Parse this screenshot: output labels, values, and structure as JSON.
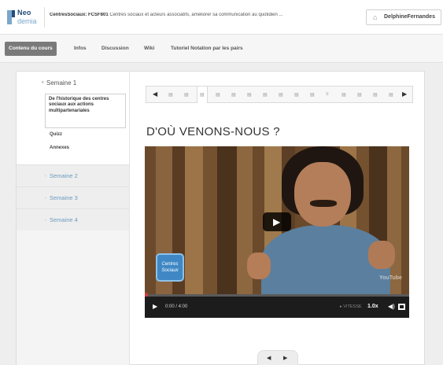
{
  "header": {
    "logo_top": "Neo",
    "logo_bottom": "demia",
    "course_code": "CentresSociaux: FCSF801",
    "course_name": "Centres sociaux et acteurs associatifs, améliorer sa communication au quotidien ...",
    "user_icon": "home-icon",
    "user_name": "DelphineFernandes"
  },
  "tabs": [
    {
      "label": "Contenu du cours",
      "active": true
    },
    {
      "label": "Infos",
      "active": false
    },
    {
      "label": "Discussion",
      "active": false
    },
    {
      "label": "Wiki",
      "active": false
    },
    {
      "label": "Tutoriel Notation par les pairs",
      "active": false
    }
  ],
  "sidebar": {
    "open_week": "Semaine 1",
    "lessons": [
      {
        "label": "De l'historique des centres sociaux aux actions multipartenariales",
        "active": true
      },
      {
        "label": "Quizz",
        "active": false
      },
      {
        "label": "Annexes",
        "active": false
      }
    ],
    "weeks": [
      "Semaine 2",
      "Semaine 3",
      "Semaine 4"
    ]
  },
  "unit_nav": {
    "prev_icon": "chevron-left-icon",
    "next_icon": "chevron-right-icon",
    "unit_count": 15,
    "active_index": 2
  },
  "main": {
    "heading": "D'OÙ VENONS-NOUS ?"
  },
  "video": {
    "logo_text": "Centres Sociaux",
    "watermark": "YouTube",
    "time": "0:00 / 4:00",
    "speed_label": "VITESSE",
    "speed_value": "1.0x",
    "progress": 0
  },
  "colors": {
    "accent": "#6c9bbd",
    "tab_active": "#7a7a7a",
    "video_controls": "#1c1c1c"
  }
}
